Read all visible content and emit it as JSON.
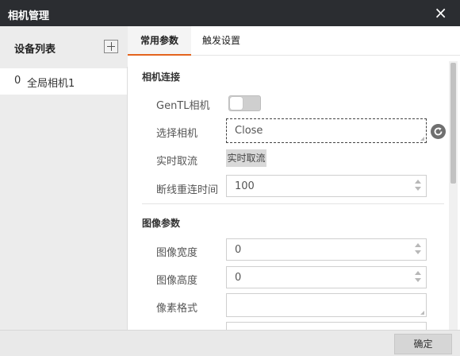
{
  "window": {
    "title": "相机管理",
    "close_icon": "×"
  },
  "sidebar": {
    "title": "设备列表",
    "add_icon": "plus-icon",
    "items": [
      {
        "index": "0",
        "label": "全局相机1"
      }
    ]
  },
  "tabs": [
    {
      "label": "常用参数",
      "active": true
    },
    {
      "label": "触发设置",
      "active": false
    }
  ],
  "camera_connection": {
    "title": "相机连接",
    "gentl_label": "GenTL相机",
    "gentl_on": false,
    "select_label": "选择相机",
    "select_value": "Close",
    "stream_label": "实时取流",
    "stream_button": "实时取流",
    "reconnect_label": "断线重连时间",
    "reconnect_value": "100"
  },
  "image_params": {
    "title": "图像参数",
    "width_label": "图像宽度",
    "width_value": "0",
    "height_label": "图像高度",
    "height_value": "0",
    "pixel_format_label": "像素格式",
    "pixel_format_value": ""
  },
  "footer": {
    "ok_label": "确定"
  },
  "colors": {
    "titlebar": "#2b2d31",
    "tab_accent": "#e3641e",
    "sidebar_bg": "#ececec"
  }
}
